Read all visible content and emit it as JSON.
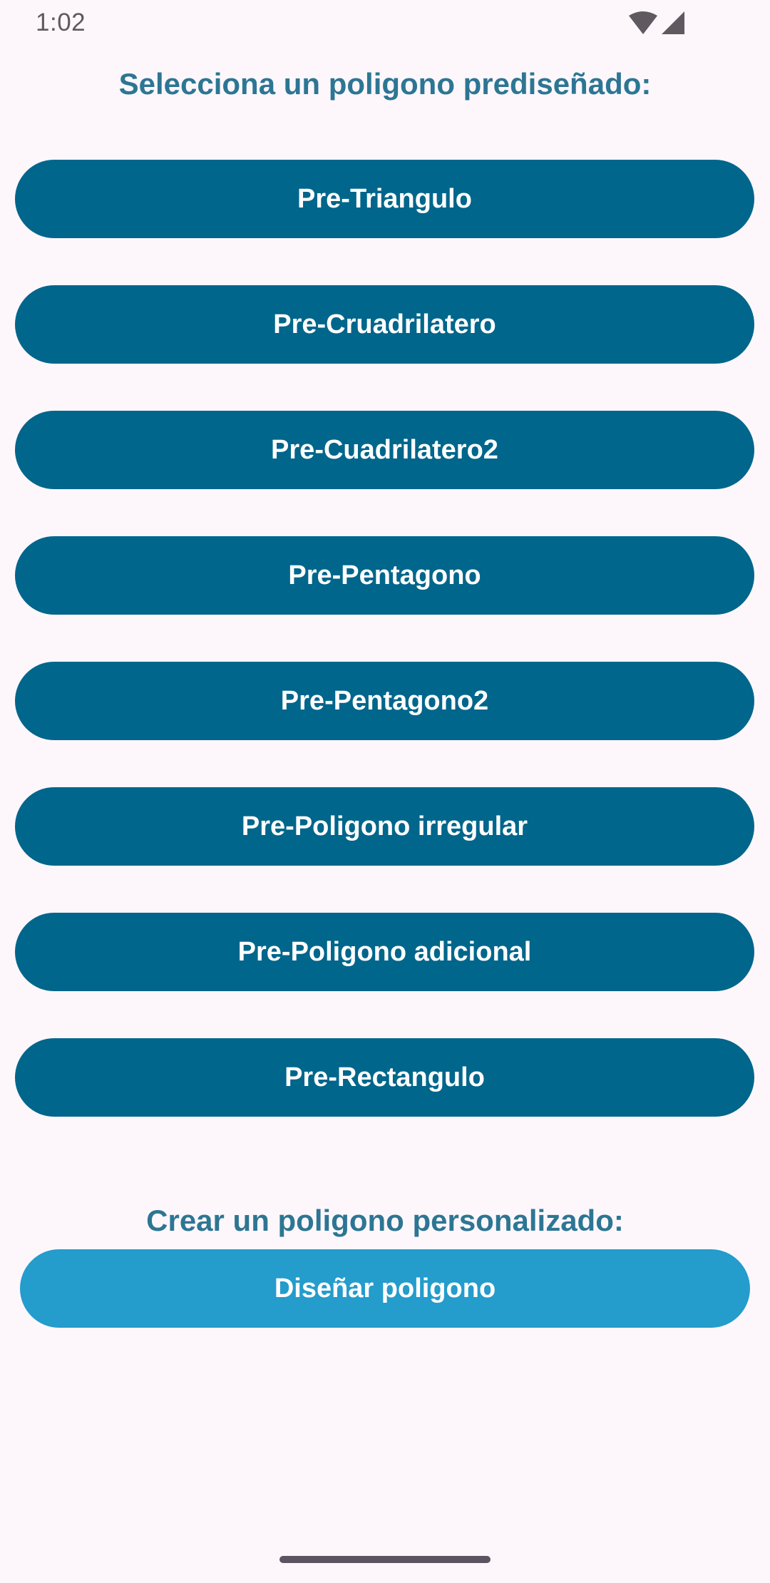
{
  "status_bar": {
    "time": "1:02",
    "icons": [
      "wifi-icon",
      "signal-icon"
    ]
  },
  "presets": {
    "heading": "Selecciona un poligono prediseñado:",
    "buttons": [
      {
        "label": "Pre-Triangulo"
      },
      {
        "label": "Pre-Cruadrilatero"
      },
      {
        "label": "Pre-Cuadrilatero2"
      },
      {
        "label": "Pre-Pentagono"
      },
      {
        "label": "Pre-Pentagono2"
      },
      {
        "label": "Pre-Poligono irregular"
      },
      {
        "label": "Pre-Poligono adicional"
      },
      {
        "label": "Pre-Rectangulo"
      }
    ]
  },
  "custom": {
    "heading": "Crear un poligono personalizado:",
    "button_label": "Diseñar poligono"
  },
  "colors": {
    "background": "#fdf7fc",
    "heading": "#2d7693",
    "preset_button": "#00668b",
    "design_button": "#249ccc",
    "button_text": "#ffffff"
  }
}
